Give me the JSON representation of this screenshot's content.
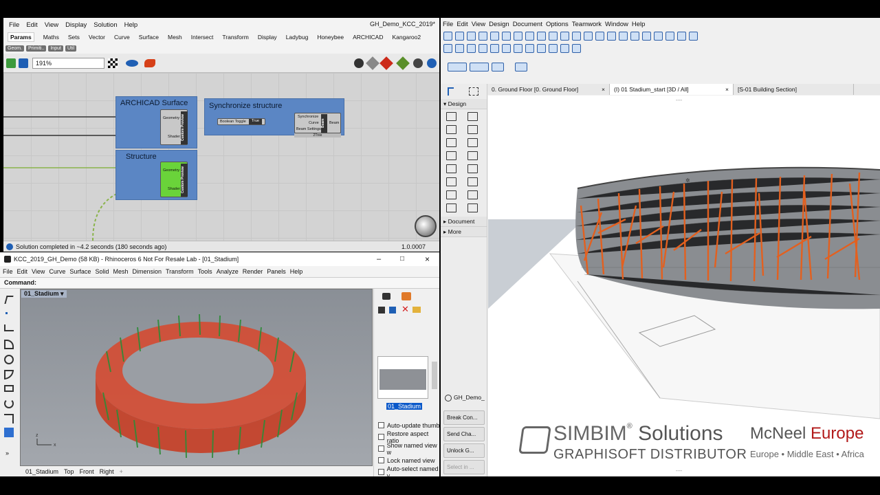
{
  "grasshopper": {
    "menu": [
      "File",
      "Edit",
      "View",
      "Display",
      "Solution",
      "Help"
    ],
    "doc_title": "GH_Demo_KCC_2019*",
    "tabs": [
      "Params",
      "Maths",
      "Sets",
      "Vector",
      "Curve",
      "Surface",
      "Mesh",
      "Intersect",
      "Transform",
      "Display",
      "Ladybug",
      "Honeybee",
      "ARCHICAD",
      "Kangaroo2"
    ],
    "active_tab": "Params",
    "subtabs": [
      "Geom.",
      "Primiti..",
      "Input",
      "Util"
    ],
    "zoom": "191%",
    "groups": {
      "archicad_surface": {
        "title": "ARCHICAD Surface",
        "inputs": [
          "Geometry",
          "Shader"
        ],
        "label": "Custom Preview"
      },
      "structure": {
        "title": "Structure",
        "inputs": [
          "Geometry",
          "Shader"
        ],
        "label": "Custom Preview"
      },
      "synchronize": {
        "title": "Synchronize structure",
        "toggle_label": "Boolean Toggle",
        "toggle_value": "True",
        "inputs": [
          "Synchronize",
          "Curve",
          "Beam Settings"
        ],
        "bar": "Beam",
        "output": "Beam",
        "footer": "2Tree"
      }
    },
    "status": "Solution completed in ~4.2 seconds (180 seconds ago)",
    "version": "1.0.0007"
  },
  "rhino": {
    "title": "KCC_2019_GH_Demo (58 KB) - Rhinoceros 6 Not For Resale Lab - [01_Stadium]",
    "menu": [
      "File",
      "Edit",
      "View",
      "Curve",
      "Surface",
      "Solid",
      "Mesh",
      "Dimension",
      "Transform",
      "Tools",
      "Analyze",
      "Render",
      "Panels",
      "Help"
    ],
    "command_label": "Command:",
    "viewport_name": "01_Stadium",
    "named_view_label": "01_Stadium",
    "options": [
      "Auto-update thumb",
      "Restore aspect ratio",
      "Show named view w",
      "Lock named view",
      "Auto-select named v"
    ],
    "bottom_tabs": [
      "01_Stadium",
      "Top",
      "Front",
      "Right"
    ]
  },
  "archicad": {
    "menu": [
      "File",
      "Edit",
      "View",
      "Design",
      "Document",
      "Options",
      "Teamwork",
      "Window",
      "Help"
    ],
    "tabs": [
      "0. Ground Floor [0. Ground Floor]",
      "(I) 01 Stadium_start [3D / All]",
      "[S-01 Building Section]"
    ],
    "toolbox_categories": [
      "Design",
      "Document",
      "More"
    ],
    "gh_label": "GH_Demo_",
    "buttons": [
      "Break Con...",
      "Send Cha...",
      "Unlock G...",
      "Select in ..."
    ]
  },
  "watermark": {
    "brand": "SIMBIM",
    "solutions": "Solutions",
    "distributor": "GRAPHISOFT DISTRIBUTOR",
    "mcneel": "McNeel",
    "europe": "Europe",
    "regions": "Europe • Middle East • Africa"
  },
  "colors": {
    "accent_blue": "#5b86c4",
    "beam_orange": "#e3601f",
    "stadium_red": "#d8472c",
    "structure_green": "#2e8b37",
    "preview_green": "#6ad33a"
  }
}
